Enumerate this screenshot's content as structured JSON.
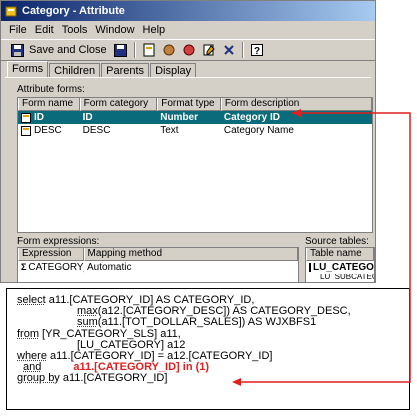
{
  "window": {
    "title": "Category - Attribute"
  },
  "menu": [
    "File",
    "Edit",
    "Tools",
    "Window",
    "Help"
  ],
  "toolbar": {
    "save_close_label": "Save and Close"
  },
  "tabs": [
    "Forms",
    "Children",
    "Parents",
    "Display"
  ],
  "attribute_forms": {
    "label": "Attribute forms:",
    "headers": [
      "Form name",
      "Form category",
      "Format type",
      "Form description"
    ],
    "rows": [
      {
        "name": "ID",
        "category": "ID",
        "format": "Number",
        "description": "Category ID"
      },
      {
        "name": "DESC",
        "category": "DESC",
        "format": "Text",
        "description": "Category Name"
      }
    ]
  },
  "form_expressions": {
    "label": "Form expressions:",
    "headers": [
      "Expression",
      "Mapping method"
    ],
    "rows": [
      {
        "expression": "CATEGORY_ID",
        "method": "Automatic"
      }
    ]
  },
  "source_tables": {
    "label": "Source tables:",
    "header": "Table name",
    "rows": [
      "LU_CATEGORY",
      "LU_SUBCATEGORY"
    ]
  },
  "sql": {
    "l1a": "select",
    "l1b": " a11.[CATEGORY_ID] AS CATEGORY_ID,",
    "l2a": "max",
    "l2b": "(a12.[CATEGORY_DESC]) AS CATEGORY_DESC,",
    "l3a": "sum",
    "l3b": "(a11.[TOT_DOLLAR_SALES]) AS WJXBFS1",
    "l4a": "from",
    "l4b": " [YR_CATEGORY_SLS] a11,",
    "l5": "[LU_CATEGORY] a12",
    "l6a": "where",
    "l6b": " a11.[CATEGORY_ID] = a12.[CATEGORY_ID]",
    "l7a": "and",
    "l7b": "a11.[CATEGORY_ID] in (1)",
    "l8a": "group by",
    "l8b": " a11.[CATEGORY_ID]"
  },
  "colors": {
    "selected_row": "#0a6b7a",
    "arrow": "#e21e1e",
    "titlebar": "#0a246a"
  }
}
